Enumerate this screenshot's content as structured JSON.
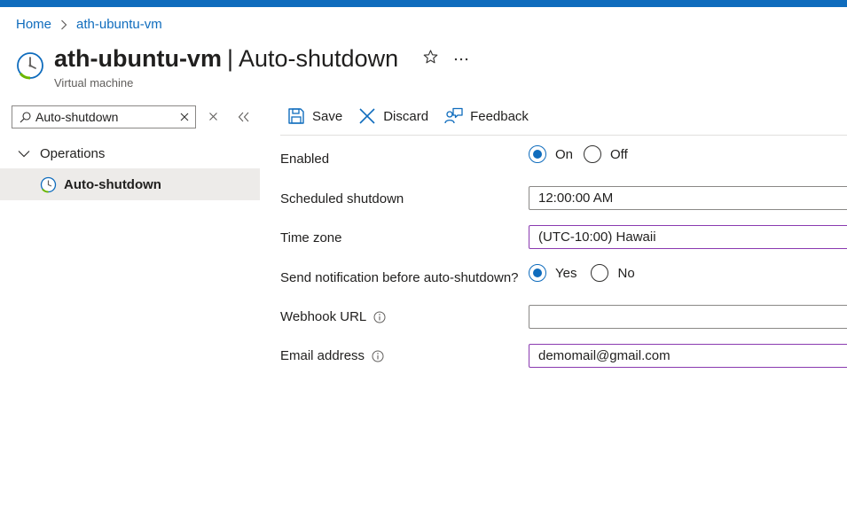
{
  "breadcrumb": {
    "home": "Home",
    "resource": "ath-ubuntu-vm"
  },
  "header": {
    "resource_name": "ath-ubuntu-vm",
    "separator": "|",
    "page_name": "Auto-shutdown",
    "subtitle": "Virtual machine",
    "more_label": "···"
  },
  "sidebar": {
    "search_value": "Auto-shutdown",
    "group_label": "Operations",
    "items": [
      {
        "label": "Auto-shutdown",
        "selected": true
      }
    ]
  },
  "toolbar": {
    "save_label": "Save",
    "discard_label": "Discard",
    "feedback_label": "Feedback"
  },
  "form": {
    "enabled": {
      "label": "Enabled",
      "options": [
        "On",
        "Off"
      ],
      "selected": "On"
    },
    "scheduled_shutdown": {
      "label": "Scheduled shutdown",
      "value": "12:00:00 AM"
    },
    "time_zone": {
      "label": "Time zone",
      "value": "(UTC-10:00) Hawaii"
    },
    "notification": {
      "label": "Send notification before auto-shutdown?",
      "options": [
        "Yes",
        "No"
      ],
      "selected": "Yes"
    },
    "webhook": {
      "label": "Webhook URL",
      "value": ""
    },
    "email": {
      "label": "Email address",
      "value": "demomail@gmail.com"
    }
  },
  "colors": {
    "accent": "#0f6cbd",
    "focus_border": "#8a3ab0",
    "selected_nav_bg": "#edebe9"
  },
  "icons": {
    "resource": "clock-icon",
    "favorite": "star-icon",
    "more": "ellipsis-icon",
    "search": "search-icon",
    "save": "save-icon",
    "discard": "close-icon",
    "feedback": "feedback-icon",
    "info": "info-icon"
  }
}
